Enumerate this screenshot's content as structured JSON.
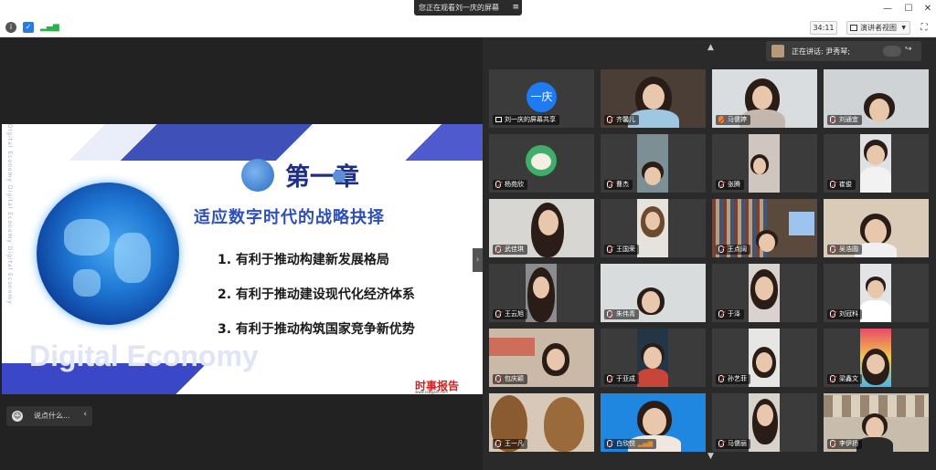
{
  "titlebar": {
    "banner_text": "您正在观看刘一庆的屏幕",
    "banner_icon": "menu-icon"
  },
  "toolbar": {
    "timer": "34:11",
    "view_label": "演讲者视图"
  },
  "slide": {
    "chapter": "第一章",
    "subtitle": "适应数字时代的战略抉择",
    "points": [
      "1. 有利于推动构建新发展格局",
      "2. 有利于推动建设现代化经济体系",
      "3. 有利于推动构筑国家竞争新优势"
    ],
    "watermark": "Digital Economy",
    "side_text": "Digital Economy Digital Economy Digital Economy",
    "logo": "时事报告",
    "logo_url": "www.ssbgzzs.com"
  },
  "chat": {
    "placeholder": "说点什么..."
  },
  "speaker": {
    "label": "正在讲话: 尹秀琴;"
  },
  "participants": [
    {
      "name": "刘一庆的屏幕共享",
      "avatar_text": "一庆"
    },
    {
      "name": "齐馨儿"
    },
    {
      "name": "马儒婷"
    },
    {
      "name": "刘通宜"
    },
    {
      "name": "杨苑欣"
    },
    {
      "name": "曹杰"
    },
    {
      "name": "张腾"
    },
    {
      "name": "崔俊"
    },
    {
      "name": "武佳琪"
    },
    {
      "name": "王国荣"
    },
    {
      "name": "王点阔"
    },
    {
      "name": "吴浩圆"
    },
    {
      "name": "王云旭"
    },
    {
      "name": "朱伟青"
    },
    {
      "name": "于泽"
    },
    {
      "name": "刘冠科"
    },
    {
      "name": "包庆颖"
    },
    {
      "name": "于亚成"
    },
    {
      "name": "孙艺菲"
    },
    {
      "name": "梁鑫文"
    },
    {
      "name": "王一凡"
    },
    {
      "name": "白欣悦"
    },
    {
      "name": "马儒丽"
    },
    {
      "name": "李伊扬"
    }
  ]
}
